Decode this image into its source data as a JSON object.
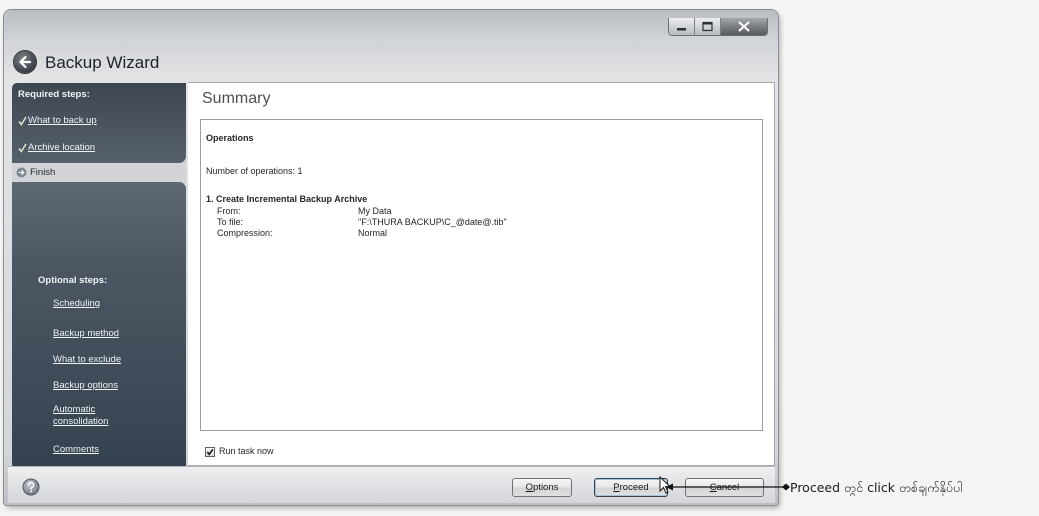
{
  "window": {
    "title": "Backup Wizard",
    "back_icon": "back-arrow-icon",
    "caption_icons": [
      "minimize-icon",
      "maximize-icon",
      "close-icon"
    ]
  },
  "sidebar": {
    "required_heading": "Required steps:",
    "required_items": [
      {
        "label": "What to back up",
        "completed": true,
        "icon": "checkmark-icon"
      },
      {
        "label": "Archive location",
        "completed": true,
        "icon": "checkmark-icon"
      },
      {
        "label": "Finish",
        "current": true,
        "icon": "current-step-arrow-icon"
      }
    ],
    "optional_heading": "Optional steps:",
    "optional_items": [
      {
        "label": "Scheduling"
      },
      {
        "label": "Backup method"
      },
      {
        "label": "What to exclude"
      },
      {
        "label": "Backup options"
      },
      {
        "label": "Automatic consolidation"
      },
      {
        "label": "Comments"
      }
    ]
  },
  "main": {
    "heading": "Summary",
    "summary_box": {
      "section_title": "Operations",
      "operations_count_text": "Number of operations: 1",
      "operation_title": "1. Create Incremental Backup Archive",
      "details": [
        {
          "key": "From:",
          "value": "My Data"
        },
        {
          "key": "To file:",
          "value": "\"F:\\THURA BACKUP\\C_@date@.tib\""
        },
        {
          "key": "Compression:",
          "value": "Normal"
        }
      ]
    },
    "run_task_now": {
      "label": "Run task now",
      "checked": true
    }
  },
  "footer": {
    "help_icon": "help-icon",
    "options_label": "Options",
    "proceed_label": "Proceed",
    "cancel_label": "Cancel"
  },
  "annotation": {
    "text": "Proceed တွင် click တစ်ချက်နှိပ်ပါ",
    "pointer_icon": "mouse-cursor-icon"
  },
  "colors": {
    "sidebar_selected": "#d2d4d7",
    "sidebar_text": "#f1f3f5",
    "content_bg": "#ffffff"
  }
}
